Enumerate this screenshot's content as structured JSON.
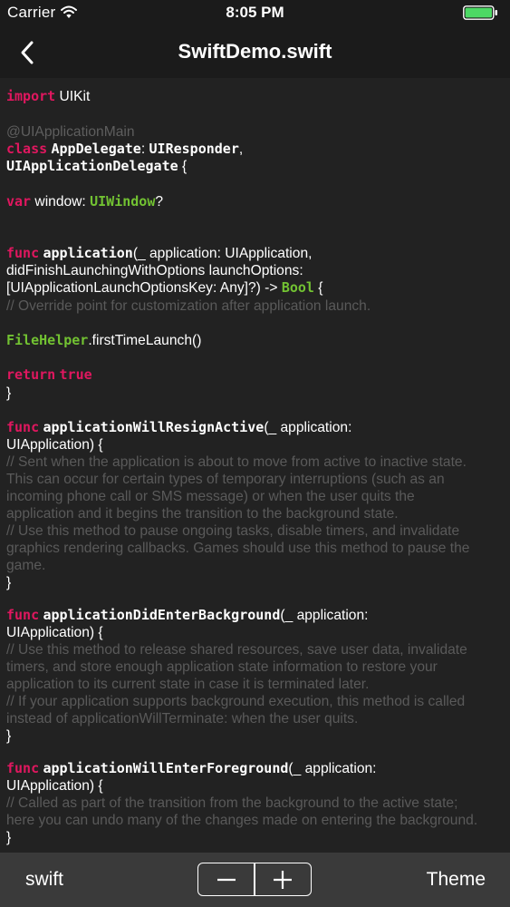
{
  "status_bar": {
    "carrier": "Carrier",
    "time": "8:05 PM",
    "battery_color": "#4cd964"
  },
  "nav": {
    "title": "SwiftDemo.swift",
    "back_icon": "chevron-left-icon"
  },
  "code": {
    "lines": [
      [
        {
          "t": "kw",
          "s": "import"
        },
        {
          "t": "plain",
          "s": " UIKit"
        }
      ],
      [
        {
          "t": "attr",
          "s": "@UIApplicationMain"
        }
      ],
      [
        {
          "t": "kw",
          "s": "class"
        },
        {
          "t": "plain",
          "s": " "
        },
        {
          "t": "fn",
          "s": "AppDelegate"
        },
        {
          "t": "plain",
          "s": ": "
        },
        {
          "t": "fn",
          "s": "UIResponder"
        },
        {
          "t": "plain",
          "s": ","
        }
      ],
      [
        {
          "t": "fn",
          "s": "UIApplicationDelegate"
        },
        {
          "t": "plain",
          "s": " {"
        }
      ],
      [
        {
          "t": "kw",
          "s": "var"
        },
        {
          "t": "plain",
          "s": " window: "
        },
        {
          "t": "ty",
          "s": "UIWindow"
        },
        {
          "t": "plain",
          "s": "?"
        }
      ],
      [
        {
          "t": "kw",
          "s": "func"
        },
        {
          "t": "plain",
          "s": " "
        },
        {
          "t": "fn",
          "s": "application"
        },
        {
          "t": "plain",
          "s": "(_ application: UIApplication,"
        }
      ],
      [
        {
          "t": "plain",
          "s": "didFinishLaunchingWithOptions launchOptions:"
        }
      ],
      [
        {
          "t": "plain",
          "s": "[UIApplicationLaunchOptionsKey: Any]?) -> "
        },
        {
          "t": "ty",
          "s": "Bool"
        },
        {
          "t": "plain",
          "s": " {"
        }
      ],
      [
        {
          "t": "comment",
          "s": "// Override point for customization after application launch."
        }
      ],
      [
        {
          "t": "ty",
          "s": "FileHelper"
        },
        {
          "t": "plain",
          "s": ".firstTimeLaunch()"
        }
      ],
      [
        {
          "t": "kw",
          "s": "return"
        },
        {
          "t": "plain",
          "s": " "
        },
        {
          "t": "kw",
          "s": "true"
        }
      ],
      [
        {
          "t": "plain",
          "s": "}"
        }
      ],
      [
        {
          "t": "kw",
          "s": "func"
        },
        {
          "t": "plain",
          "s": " "
        },
        {
          "t": "fn",
          "s": "applicationWillResignActive"
        },
        {
          "t": "plain",
          "s": "(_ application:"
        }
      ],
      [
        {
          "t": "plain",
          "s": "UIApplication) {"
        }
      ],
      [
        {
          "t": "comment",
          "s": "// Sent when the application is about to move from active to inactive state."
        }
      ],
      [
        {
          "t": "comment",
          "s": "This can occur for certain types of temporary interruptions (such as an"
        }
      ],
      [
        {
          "t": "comment",
          "s": "incoming phone call or SMS message) or when the user quits the"
        }
      ],
      [
        {
          "t": "comment",
          "s": "application and it begins the transition to the background state."
        }
      ],
      [
        {
          "t": "comment",
          "s": "// Use this method to pause ongoing tasks, disable timers, and invalidate"
        }
      ],
      [
        {
          "t": "comment",
          "s": "graphics rendering callbacks. Games should use this method to pause the"
        }
      ],
      [
        {
          "t": "comment",
          "s": "game."
        }
      ],
      [
        {
          "t": "plain",
          "s": "}"
        }
      ],
      [
        {
          "t": "kw",
          "s": "func"
        },
        {
          "t": "plain",
          "s": " "
        },
        {
          "t": "fn",
          "s": "applicationDidEnterBackground"
        },
        {
          "t": "plain",
          "s": "(_ application:"
        }
      ],
      [
        {
          "t": "plain",
          "s": "UIApplication) {"
        }
      ],
      [
        {
          "t": "comment",
          "s": "// Use this method to release shared resources, save user data, invalidate"
        }
      ],
      [
        {
          "t": "comment",
          "s": "timers, and store enough application state information to restore your"
        }
      ],
      [
        {
          "t": "comment",
          "s": "application to its current state in case it is terminated later."
        }
      ],
      [
        {
          "t": "comment",
          "s": "// If your application supports background execution, this method is called"
        }
      ],
      [
        {
          "t": "comment",
          "s": "instead of applicationWillTerminate: when the user quits."
        }
      ],
      [
        {
          "t": "plain",
          "s": "}"
        }
      ],
      [
        {
          "t": "kw",
          "s": "func"
        },
        {
          "t": "plain",
          "s": " "
        },
        {
          "t": "fn",
          "s": "applicationWillEnterForeground"
        },
        {
          "t": "plain",
          "s": "(_ application:"
        }
      ],
      [
        {
          "t": "plain",
          "s": "UIApplication) {"
        }
      ],
      [
        {
          "t": "comment",
          "s": "// Called as part of the transition from the background to the active state;"
        }
      ],
      [
        {
          "t": "comment",
          "s": "here you can undo many of the changes made on entering the background."
        }
      ],
      [
        {
          "t": "plain",
          "s": "}"
        }
      ]
    ]
  },
  "toolbar": {
    "language": "swift",
    "decrease_icon": "minus-icon",
    "increase_icon": "plus-icon",
    "theme": "Theme"
  }
}
